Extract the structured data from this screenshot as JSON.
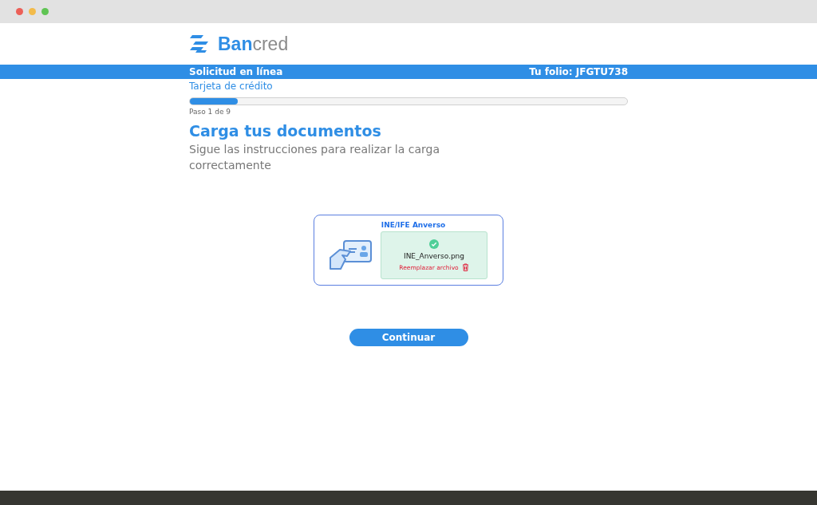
{
  "logo": {
    "primary": "Ban",
    "secondary": "cred"
  },
  "header_bar": {
    "title": "Solicitud en línea",
    "folio": "Tu folio: JFGTU738"
  },
  "product": "Tarjeta de crédito",
  "progress": {
    "level": 0.11,
    "label": "Paso 1 de 9"
  },
  "heading": "Carga tus documentos",
  "instructions": "Sigue las instrucciones para realizar la carga correctamente",
  "upload_card": {
    "title": "INE/IFE Anverso",
    "uploaded": true,
    "file_name": "INE_Anverso.png",
    "replace_link": "Reemplazar archivo"
  },
  "buttons": [
    "Continuar"
  ]
}
